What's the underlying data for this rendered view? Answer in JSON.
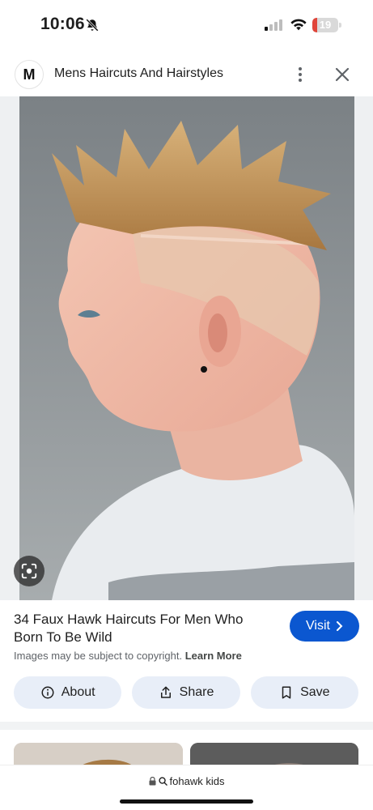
{
  "status_bar": {
    "time": "10:06",
    "battery_level": "19",
    "icons": [
      "bell-off-icon",
      "signal-icon",
      "wifi-icon",
      "battery-icon"
    ]
  },
  "header": {
    "logo_letter": "M",
    "title": "Mens Haircuts And Hairstyles",
    "more_icon": "more-vert-icon",
    "close_icon": "close-icon"
  },
  "result": {
    "title": "34 Faux Hawk Haircuts For Men Who Born To Be Wild",
    "visit_label": "Visit",
    "copyright_text": "Images may be subject to copyright.",
    "learn_more": "Learn More"
  },
  "actions": [
    {
      "label": "About",
      "icon": "info-icon"
    },
    {
      "label": "Share",
      "icon": "share-icon"
    },
    {
      "label": "Save",
      "icon": "bookmark-icon"
    }
  ],
  "bottom_bar": {
    "query": "fohawk kids"
  },
  "colors": {
    "accent": "#0b57d0",
    "chip_bg": "#e8eef8",
    "battery_low": "#e0453a"
  }
}
